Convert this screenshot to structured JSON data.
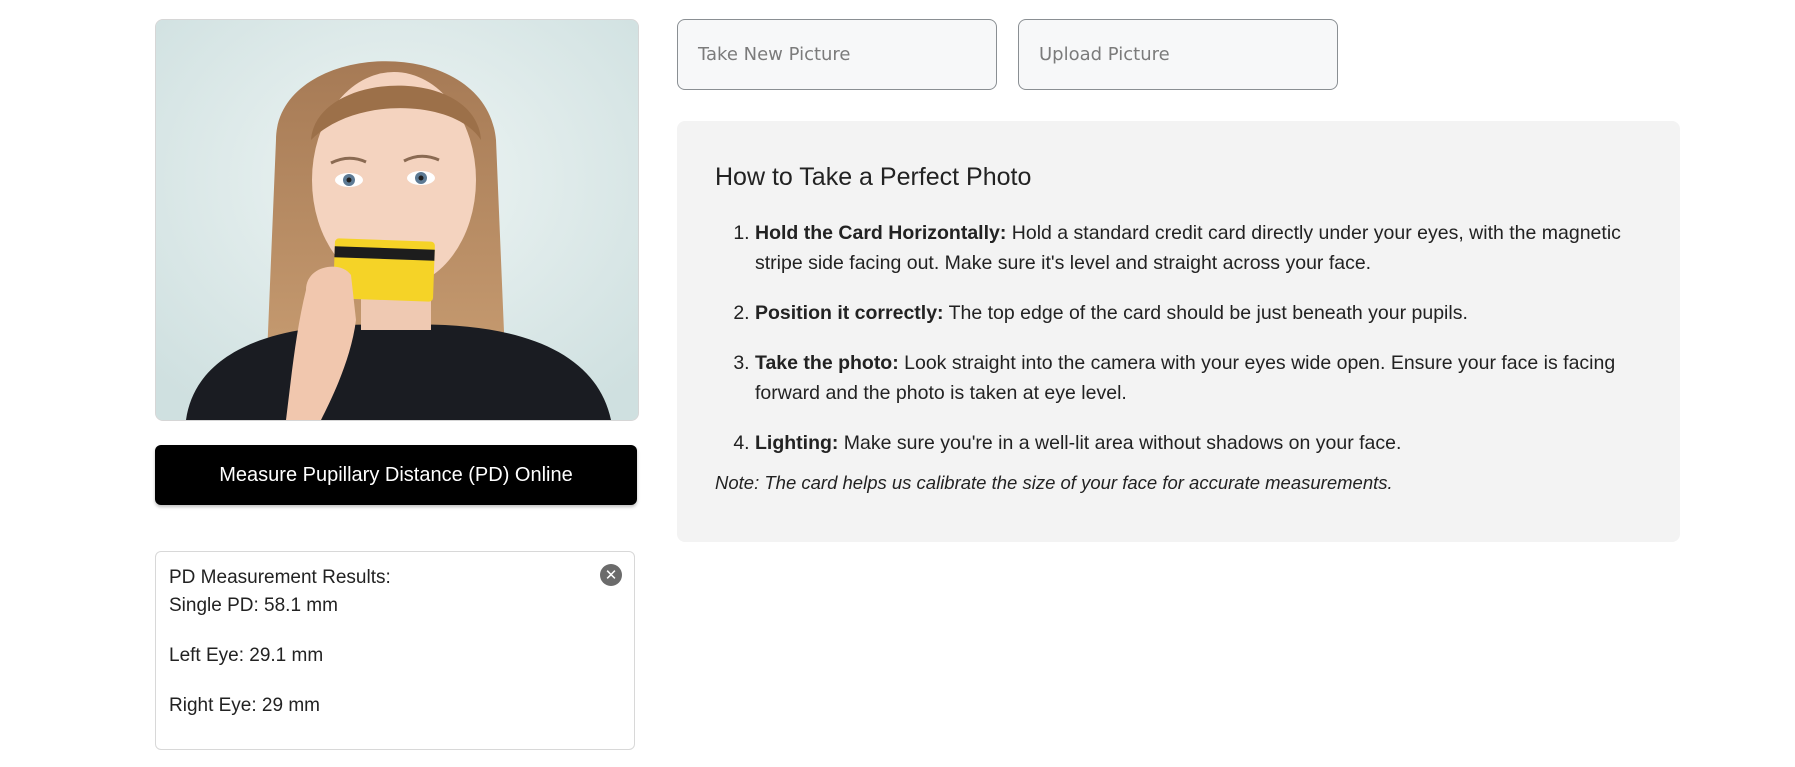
{
  "buttons": {
    "take_picture": "Take New Picture",
    "upload_picture": "Upload Picture",
    "measure": "Measure Pupillary Distance (PD) Online"
  },
  "photo": {
    "description_icon": "woman-holding-card-photo"
  },
  "results": {
    "title": "PD Measurement Results:",
    "single_pd": "Single PD: 58.1 mm",
    "left_eye": "Left Eye: 29.1 mm",
    "right_eye": "Right Eye: 29 mm",
    "close_icon": "close-icon"
  },
  "instructions": {
    "title": "How to Take a Perfect Photo",
    "steps": [
      {
        "label": "Hold the Card Horizontally:",
        "text": " Hold a standard credit card directly under your eyes, with the magnetic stripe side facing out. Make sure it's level and straight across your face."
      },
      {
        "label": "Position it correctly:",
        "text": " The top edge of the card should be just beneath your pupils."
      },
      {
        "label": "Take the photo:",
        "text": " Look straight into the camera with your eyes wide open. Ensure your face is facing forward and the photo is taken at eye level."
      },
      {
        "label": "Lighting:",
        "text": " Make sure you're in a well-lit area without shadows on your face."
      }
    ],
    "note": "Note: The card helps us calibrate the size of your face for accurate measurements."
  },
  "colors": {
    "measure_button_bg": "#000000",
    "instructions_bg": "#f3f3f3",
    "card_yellow": "#f5d327"
  }
}
